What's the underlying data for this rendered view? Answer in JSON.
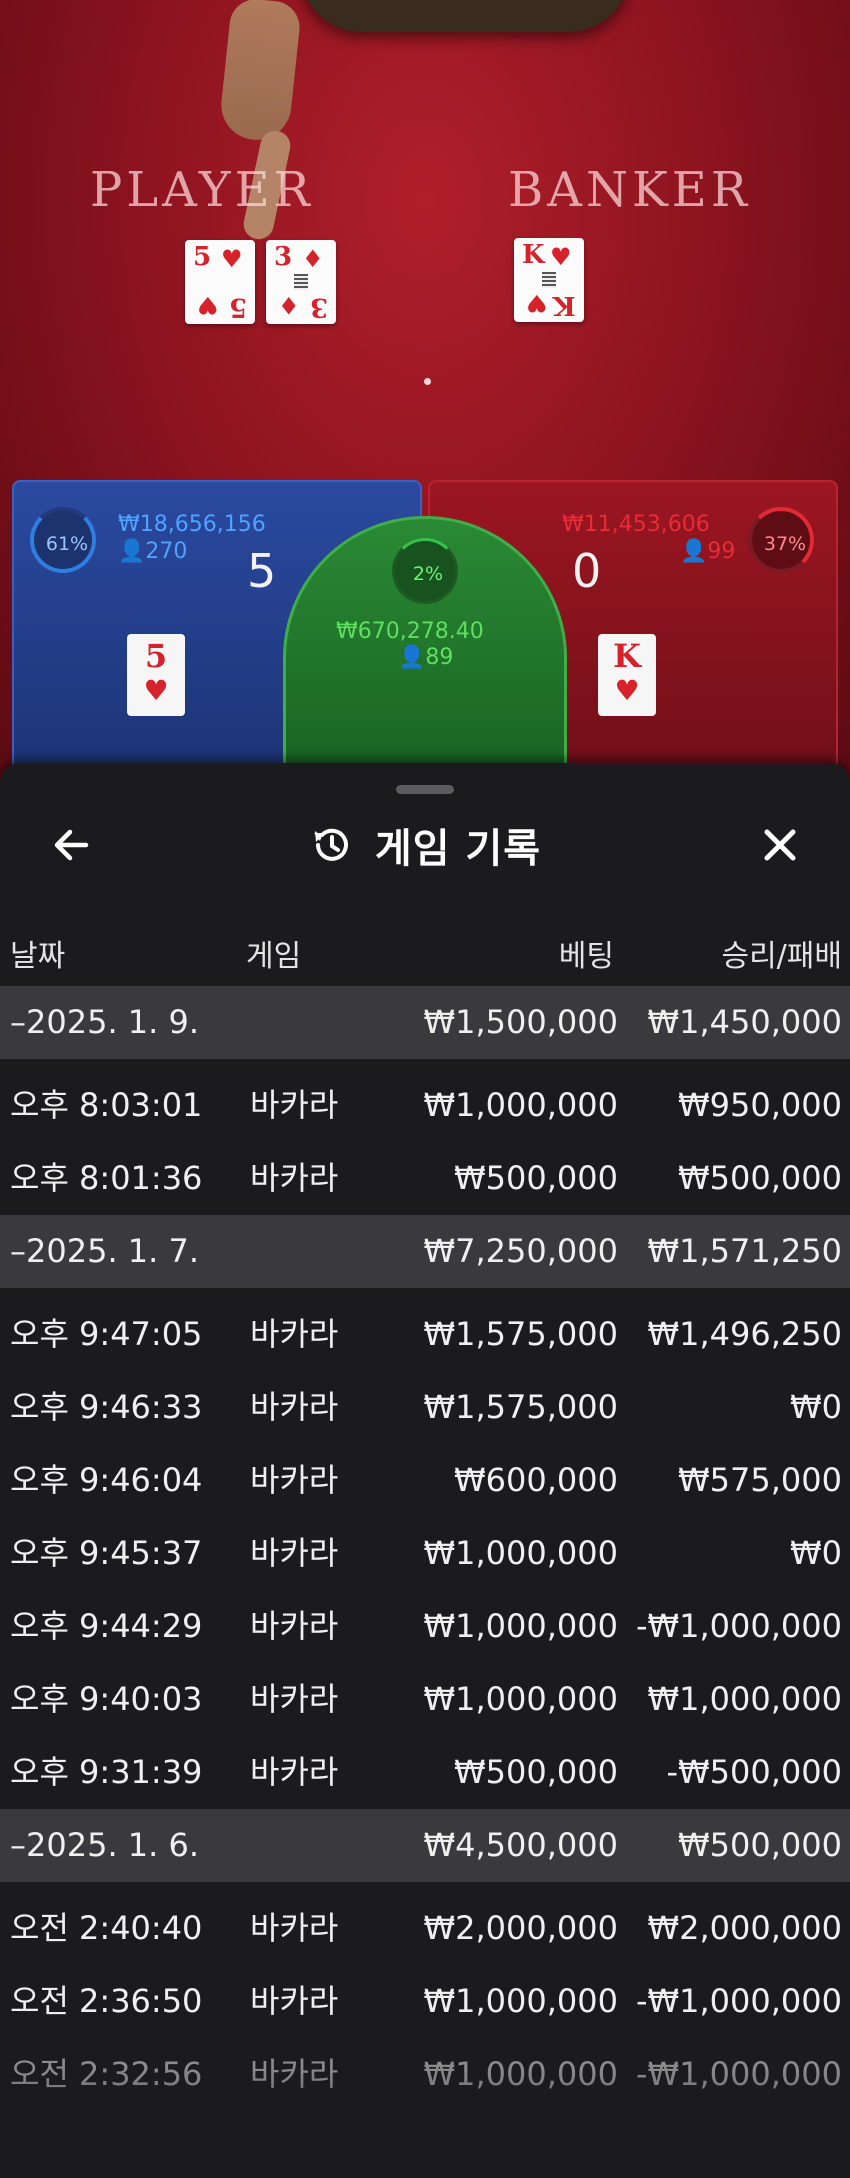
{
  "game": {
    "player_label": "PLAYER",
    "banker_label": "BANKER",
    "table_cards": {
      "player": [
        {
          "rank": "5",
          "suit": "♥"
        },
        {
          "rank": "3",
          "suit": "♦"
        }
      ],
      "banker": [
        {
          "rank": "K",
          "suit": "♥"
        }
      ]
    },
    "player": {
      "percent": "61%",
      "amount": "₩18,656,156",
      "count": "270",
      "score": "5",
      "card_rank": "5",
      "card_suit": "♥"
    },
    "tie": {
      "percent": "2%",
      "amount": "₩670,278.40",
      "count": "89"
    },
    "banker": {
      "percent": "37%",
      "amount": "₩11,453,606",
      "count": "99",
      "score": "0",
      "card_rank": "K",
      "card_suit": "♥"
    },
    "colors": {
      "player": "#2b4aa0",
      "banker": "#9b1622",
      "tie": "#2a8a34"
    }
  },
  "history": {
    "title": "게임 기록",
    "icons": {
      "back": "arrow-left-icon",
      "history": "history-icon",
      "close": "close-icon"
    },
    "columns": {
      "date": "날짜",
      "game": "게임",
      "bet": "베팅",
      "result": "승리/패배"
    },
    "groups": [
      {
        "date": "–2025. 1. 9.",
        "bet_total": "₩1,500,000",
        "result_total": "₩1,450,000",
        "rows": [
          {
            "time": "오후 8:03:01",
            "game": "바카라",
            "bet": "₩1,000,000",
            "result": "₩950,000"
          },
          {
            "time": "오후 8:01:36",
            "game": "바카라",
            "bet": "₩500,000",
            "result": "₩500,000"
          }
        ]
      },
      {
        "date": "–2025. 1. 7.",
        "bet_total": "₩7,250,000",
        "result_total": "₩1,571,250",
        "rows": [
          {
            "time": "오후 9:47:05",
            "game": "바카라",
            "bet": "₩1,575,000",
            "result": "₩1,496,250"
          },
          {
            "time": "오후 9:46:33",
            "game": "바카라",
            "bet": "₩1,575,000",
            "result": "₩0"
          },
          {
            "time": "오후 9:46:04",
            "game": "바카라",
            "bet": "₩600,000",
            "result": "₩575,000"
          },
          {
            "time": "오후 9:45:37",
            "game": "바카라",
            "bet": "₩1,000,000",
            "result": "₩0"
          },
          {
            "time": "오후 9:44:29",
            "game": "바카라",
            "bet": "₩1,000,000",
            "result": "-₩1,000,000"
          },
          {
            "time": "오후 9:40:03",
            "game": "바카라",
            "bet": "₩1,000,000",
            "result": "₩1,000,000"
          },
          {
            "time": "오후 9:31:39",
            "game": "바카라",
            "bet": "₩500,000",
            "result": "-₩500,000"
          }
        ]
      },
      {
        "date": "–2025. 1. 6.",
        "bet_total": "₩4,500,000",
        "result_total": "₩500,000",
        "rows": [
          {
            "time": "오전 2:40:40",
            "game": "바카라",
            "bet": "₩2,000,000",
            "result": "₩2,000,000"
          },
          {
            "time": "오전 2:36:50",
            "game": "바카라",
            "bet": "₩1,000,000",
            "result": "-₩1,000,000"
          },
          {
            "time": "오전 2:32:56",
            "game": "바카라",
            "bet": "₩1,000,000",
            "result": "-₩1,000,000"
          }
        ]
      }
    ]
  }
}
